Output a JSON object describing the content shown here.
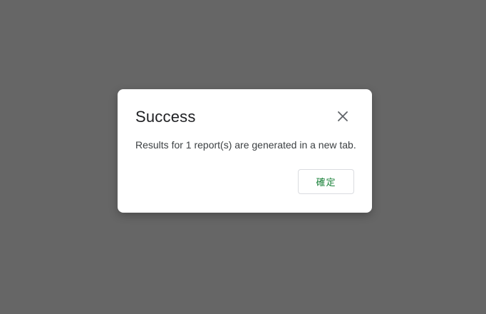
{
  "dialog": {
    "title": "Success",
    "message": "Results for 1 report(s) are generated in a new tab.",
    "confirm_label": "確定",
    "close_icon": "close-icon"
  },
  "colors": {
    "backdrop": "#666666",
    "dialog_bg": "#ffffff",
    "accent": "#188038"
  }
}
